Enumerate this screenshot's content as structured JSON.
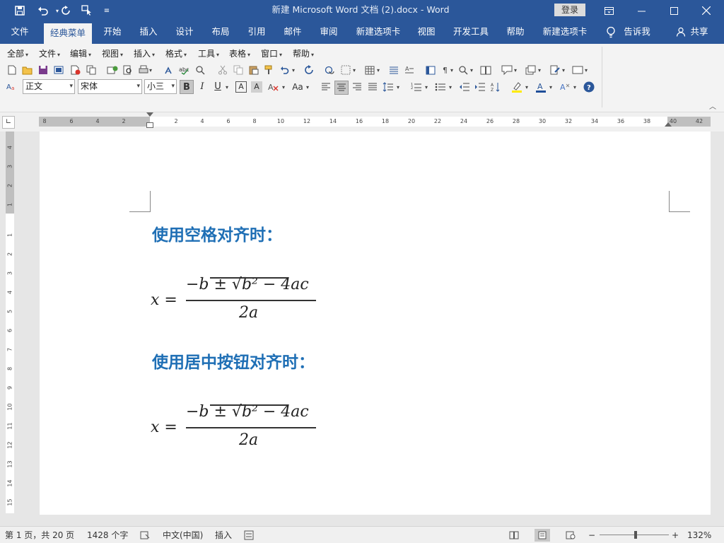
{
  "app": {
    "title": "新建 Microsoft Word 文档 (2).docx  -  Word",
    "login": "登录"
  },
  "quick_access": [
    "save-icon",
    "undo-icon",
    "redo-icon",
    "touch-mode-icon",
    "customize-qa-icon"
  ],
  "window_controls": [
    "ribbon-display-icon",
    "minimize-icon",
    "maximize-icon",
    "close-icon"
  ],
  "ribbon_tabs": [
    {
      "label": "文件"
    },
    {
      "label": "经典菜单",
      "active": true
    },
    {
      "label": "开始"
    },
    {
      "label": "插入"
    },
    {
      "label": "设计"
    },
    {
      "label": "布局"
    },
    {
      "label": "引用"
    },
    {
      "label": "邮件"
    },
    {
      "label": "审阅"
    },
    {
      "label": "新建选项卡"
    },
    {
      "label": "视图"
    },
    {
      "label": "开发工具"
    },
    {
      "label": "帮助"
    },
    {
      "label": "新建选项卡"
    }
  ],
  "tell_me": "告诉我",
  "share": "共享",
  "classic_menu": [
    "全部",
    "文件",
    "编辑",
    "视图",
    "插入",
    "格式",
    "工具",
    "表格",
    "窗口",
    "帮助"
  ],
  "format_bar": {
    "style": "正文",
    "font": "宋体",
    "size": "小三",
    "bold": "B",
    "italic": "I",
    "underline": "U",
    "char_border": "A",
    "char_shading": "A",
    "change_case": "Aa"
  },
  "ruler": {
    "h_left_numbers": [
      "8",
      "6",
      "4",
      "2"
    ],
    "h_right_numbers": [
      "2",
      "4",
      "6",
      "8",
      "10",
      "12",
      "14",
      "16",
      "18",
      "20",
      "22",
      "24",
      "26",
      "28",
      "30",
      "32",
      "34",
      "36",
      "38",
      "40",
      "42"
    ],
    "v_top_numbers": [
      "4",
      "3",
      "2",
      "1"
    ],
    "v_numbers": [
      "1",
      "2",
      "3",
      "4",
      "5",
      "6",
      "7",
      "8",
      "9",
      "10",
      "11",
      "12",
      "13",
      "14",
      "15"
    ]
  },
  "document": {
    "heading1": "使用空格对齐时：",
    "heading2": "使用居中按钮对齐时：",
    "equation": {
      "lhs": "x =",
      "numerator": "−b ± √b² − 4ac",
      "denominator": "2a"
    }
  },
  "status": {
    "page": "第 1 页，共 20 页",
    "words": "1428 个字",
    "language": "中文(中国)",
    "mode": "插入",
    "zoom": "132%",
    "zoom_minus": "−",
    "zoom_plus": "+"
  }
}
